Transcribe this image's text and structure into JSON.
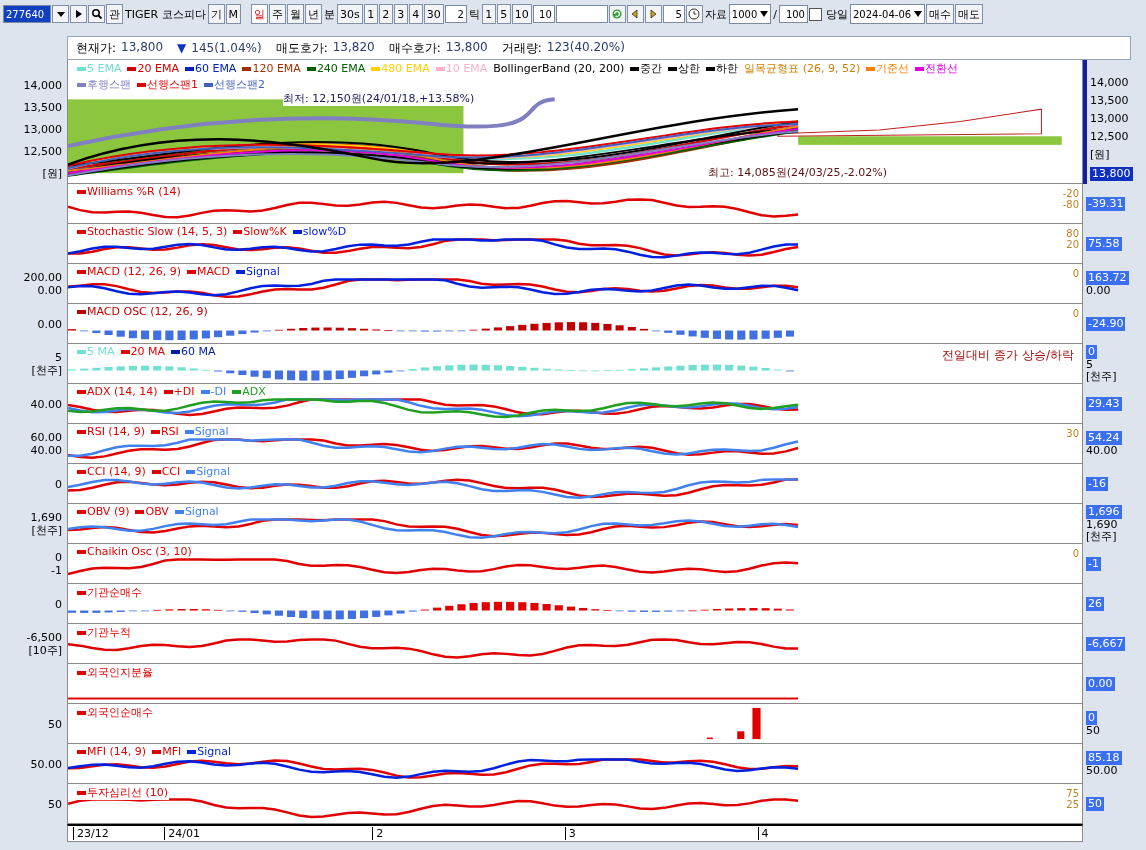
{
  "toolbar": {
    "items": [
      {
        "kind": "codebox",
        "value": "277640"
      },
      {
        "kind": "dropdown"
      },
      {
        "kind": "play"
      },
      {
        "kind": "search"
      },
      {
        "kind": "button",
        "label": "관",
        "selected": false
      },
      {
        "kind": "label",
        "label": "TIGER 코스피다"
      },
      {
        "kind": "button",
        "label": "기",
        "selected": false
      },
      {
        "kind": "button",
        "label": "M",
        "selected": false
      },
      {
        "kind": "gap"
      },
      {
        "kind": "button",
        "label": "일",
        "selected": true
      },
      {
        "kind": "button",
        "label": "주",
        "selected": false
      },
      {
        "kind": "button",
        "label": "월",
        "selected": false
      },
      {
        "kind": "button",
        "label": "년",
        "selected": false
      },
      {
        "kind": "label",
        "label": "분"
      },
      {
        "kind": "button",
        "label": "30s",
        "selected": false
      },
      {
        "kind": "button",
        "label": "1",
        "selected": false
      },
      {
        "kind": "button",
        "label": "2",
        "selected": false
      },
      {
        "kind": "button",
        "label": "3",
        "selected": false
      },
      {
        "kind": "button",
        "label": "4",
        "selected": false
      },
      {
        "kind": "button",
        "label": "30",
        "selected": false
      },
      {
        "kind": "input",
        "value": "2"
      },
      {
        "kind": "label",
        "label": "틱"
      },
      {
        "kind": "button",
        "label": "1",
        "selected": false
      },
      {
        "kind": "button",
        "label": "5",
        "selected": false
      },
      {
        "kind": "button",
        "label": "10",
        "selected": false
      },
      {
        "kind": "input",
        "value": "10"
      },
      {
        "kind": "blank"
      },
      {
        "kind": "refresh"
      },
      {
        "kind": "prev"
      },
      {
        "kind": "next"
      },
      {
        "kind": "input",
        "value": "5"
      },
      {
        "kind": "clock"
      },
      {
        "kind": "label",
        "label": "자료"
      },
      {
        "kind": "select",
        "value": "1000"
      },
      {
        "kind": "label",
        "label": "/"
      },
      {
        "kind": "input",
        "value": "100"
      },
      {
        "kind": "checkbox",
        "checked": false,
        "label": "당일"
      },
      {
        "kind": "select",
        "value": "2024-04-06"
      },
      {
        "kind": "button",
        "label": "매수",
        "selected": false
      },
      {
        "kind": "button",
        "label": "매도",
        "selected": false
      }
    ]
  },
  "quote": [
    {
      "label": "현재가:",
      "value": "13,800"
    },
    {
      "label": "▼",
      "value": "145(1.04%)"
    },
    {
      "label": "매도호가:",
      "value": "13,820"
    },
    {
      "label": "매수호가:",
      "value": "13,800"
    },
    {
      "label": "거래량:",
      "value": "123(40.20%)"
    }
  ],
  "main_chart": {
    "legend": [
      [
        {
          "label": "5 EMA",
          "color": "#70e0d0",
          "swatch": true
        },
        {
          "label": "20 EMA",
          "color": "#d00000",
          "swatch": true
        },
        {
          "label": "60 EMA",
          "color": "#0020c0",
          "swatch": true
        },
        {
          "label": "120 EMA",
          "color": "#a03000",
          "swatch": true
        },
        {
          "label": "240 EMA",
          "color": "#006000",
          "swatch": true
        },
        {
          "label": "480 EMA",
          "color": "#ffd000",
          "swatch": true
        },
        {
          "label": "10 EMA",
          "color": "#ffb0c8",
          "swatch": true
        },
        {
          "label": "BollingerBand (20, 200)",
          "color": "#000000",
          "swatch": false
        },
        {
          "label": "중간",
          "color": "#000000",
          "swatch": true
        },
        {
          "label": "상한",
          "color": "#000000",
          "swatch": true
        },
        {
          "label": "하한",
          "color": "#000000",
          "swatch": true
        },
        {
          "label": "일목균형표 (26, 9, 52)",
          "color": "#d08000",
          "swatch": false
        },
        {
          "label": "기준선",
          "color": "#ff8000",
          "swatch": true
        },
        {
          "label": "전환선",
          "color": "#e000e0",
          "swatch": true
        }
      ],
      [
        {
          "label": "후행스팬",
          "color": "#8080c0",
          "swatch": true
        },
        {
          "label": "선행스팬1",
          "color": "#e00000",
          "swatch": true
        },
        {
          "label": "선행스팬2",
          "color": "#4060c0",
          "swatch": true
        }
      ]
    ],
    "low_note": "최저: 12,150원(24/01/18,+13.58%)",
    "high_note": "최고: 14,085원(24/03/25,-2.02%)",
    "left_ticks": [
      "14,000",
      "13,500",
      "13,000",
      "12,500",
      "[원]"
    ],
    "right_ticks": [
      "14,000",
      "13,500",
      "13,000",
      "12,500",
      "[원]"
    ],
    "badge": "13,800"
  },
  "panels": [
    {
      "kind": "line",
      "legend": [
        {
          "label": "Williams %R (14)",
          "color": "#e00000"
        }
      ],
      "inner": [
        "-20",
        "-80"
      ],
      "badge": "-39.31"
    },
    {
      "kind": "line",
      "legend": [
        {
          "label": "Stochastic Slow (14, 5, 3)",
          "color": "#e00000"
        },
        {
          "label": "Slow%K",
          "color": "#e00000"
        },
        {
          "label": "slow%D",
          "color": "#0020e0"
        }
      ],
      "inner": [
        "80",
        "20"
      ],
      "badge": "75.58"
    },
    {
      "kind": "line",
      "legend": [
        {
          "label": "MACD (12, 26, 9)",
          "color": "#e00000"
        },
        {
          "label": "MACD",
          "color": "#e00000"
        },
        {
          "label": "Signal",
          "color": "#0020e0"
        }
      ],
      "left_ticks": [
        "200.00",
        "0.00"
      ],
      "inner": [
        "0"
      ],
      "badge": "163.72",
      "right_ticks": [
        "0.00"
      ]
    },
    {
      "kind": "bars",
      "legend": [
        {
          "label": "MACD OSC (12, 26, 9)",
          "color": "#c00000"
        }
      ],
      "left_ticks": [
        "0.00"
      ],
      "inner": [
        "0"
      ],
      "badge": "-24.90"
    },
    {
      "kind": "bars",
      "legend": [
        {
          "label": "5 MA",
          "color": "#70e0d0"
        },
        {
          "label": "20 MA",
          "color": "#e00000"
        },
        {
          "label": "60 MA",
          "color": "#0020a0"
        }
      ],
      "left_ticks": [
        "5",
        "[천주]"
      ],
      "note": "전일대비 종가 상승/하락",
      "badge": "0",
      "right_ticks": [
        "5",
        "[천주]"
      ]
    },
    {
      "kind": "line",
      "legend": [
        {
          "label": "ADX (14, 14)",
          "color": "#e00000"
        },
        {
          "label": "+DI",
          "color": "#e00000"
        },
        {
          "label": "-DI",
          "color": "#4080f0"
        },
        {
          "label": "ADX",
          "color": "#20a020"
        }
      ],
      "left_ticks": [
        "40.00"
      ],
      "badge": "29.43"
    },
    {
      "kind": "line",
      "legend": [
        {
          "label": "RSI (14, 9)",
          "color": "#e00000"
        },
        {
          "label": "RSI",
          "color": "#e00000"
        },
        {
          "label": "Signal",
          "color": "#4080f0"
        }
      ],
      "left_ticks": [
        "60.00",
        "40.00"
      ],
      "inner": [
        "30"
      ],
      "badge": "54.24",
      "right_ticks": [
        "40.00"
      ]
    },
    {
      "kind": "line",
      "legend": [
        {
          "label": "CCI (14, 9)",
          "color": "#e00000"
        },
        {
          "label": "CCI",
          "color": "#e00000"
        },
        {
          "label": "Signal",
          "color": "#4080f0"
        }
      ],
      "left_ticks": [
        "0"
      ],
      "badge": "-16"
    },
    {
      "kind": "line",
      "legend": [
        {
          "label": "OBV (9)",
          "color": "#e00000"
        },
        {
          "label": "OBV",
          "color": "#e00000"
        },
        {
          "label": "Signal",
          "color": "#4080f0"
        }
      ],
      "left_ticks": [
        "1,690",
        "[천주]"
      ],
      "badge": "1,696",
      "right_ticks": [
        "1,690",
        "[천주]"
      ]
    },
    {
      "kind": "line",
      "legend": [
        {
          "label": "Chaikin Osc (3, 10)",
          "color": "#e00000"
        }
      ],
      "left_ticks": [
        "0",
        "-1"
      ],
      "inner": [
        "0"
      ],
      "badge": "-1"
    },
    {
      "kind": "bars",
      "legend": [
        {
          "label": "기관순매수",
          "color": "#e00000"
        }
      ],
      "left_ticks": [
        "0"
      ],
      "badge": "26"
    },
    {
      "kind": "line",
      "legend": [
        {
          "label": "기관누적",
          "color": "#e00000"
        }
      ],
      "left_ticks": [
        "-6,500",
        "[10주]"
      ],
      "badge": "-6,667"
    },
    {
      "kind": "flat",
      "legend": [
        {
          "label": "외국인지분율",
          "color": "#e00000"
        }
      ],
      "badge": "0.00"
    },
    {
      "kind": "spikes",
      "legend": [
        {
          "label": "외국인순매수",
          "color": "#e00000"
        }
      ],
      "left_ticks": [
        "50"
      ],
      "badge": "0",
      "right_ticks": [
        "50"
      ]
    },
    {
      "kind": "line",
      "legend": [
        {
          "label": "MFI (14, 9)",
          "color": "#e00000"
        },
        {
          "label": "MFI",
          "color": "#e00000"
        },
        {
          "label": "Signal",
          "color": "#0020e0"
        }
      ],
      "left_ticks": [
        "50.00"
      ],
      "badge": "85.18",
      "right_ticks": [
        "50.00"
      ]
    },
    {
      "kind": "line",
      "legend": [
        {
          "label": "투자심리선 (10)",
          "color": "#e00000"
        }
      ],
      "left_ticks": [
        "50"
      ],
      "inner": [
        "75",
        "25"
      ],
      "badge": "50"
    }
  ],
  "x_axis": [
    "23/12",
    "24/01",
    "2",
    "3",
    "4"
  ]
}
